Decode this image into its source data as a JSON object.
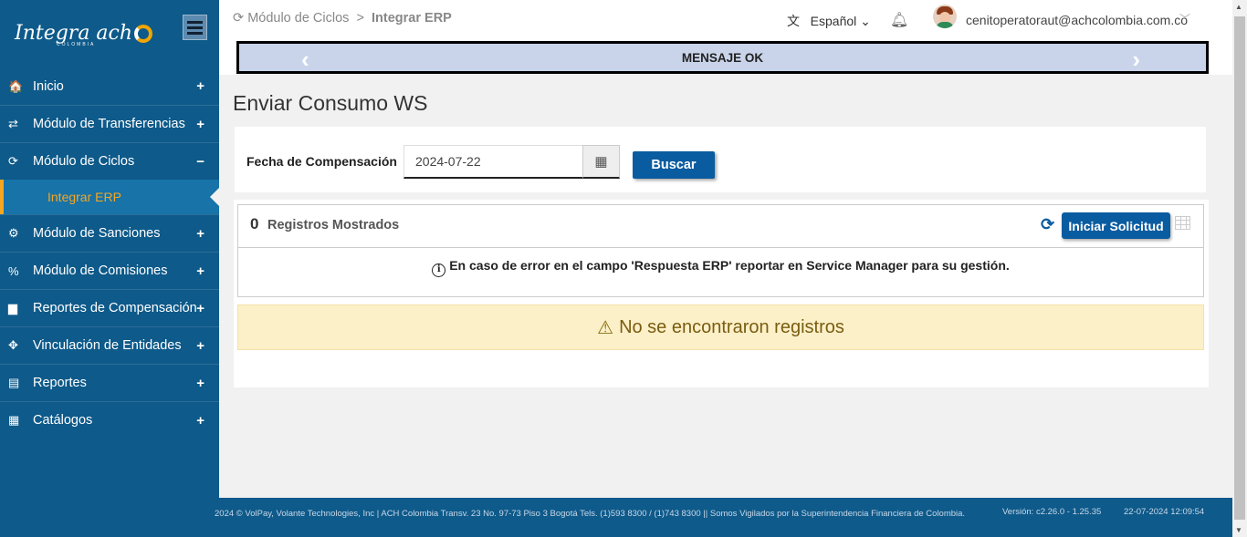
{
  "sidebar": {
    "logo_text": "Integra ach",
    "logo_sub": "COLOMBIA",
    "items": [
      {
        "icon": "home-icon",
        "glyph": "🏠",
        "label": "Inicio",
        "sign": "+"
      },
      {
        "icon": "exchange-icon",
        "glyph": "⇄",
        "label": "Módulo de Transferencias",
        "sign": "+"
      },
      {
        "icon": "refresh-icon",
        "glyph": "⟳",
        "label": "Módulo de Ciclos",
        "sign": "−"
      },
      {
        "icon": "gear-icon",
        "glyph": "⚙",
        "label": "Módulo de Sanciones",
        "sign": "+"
      },
      {
        "icon": "percent-icon",
        "glyph": "%",
        "label": "Módulo de Comisiones",
        "sign": "+"
      },
      {
        "icon": "file-icon",
        "glyph": "▆",
        "label": "Reportes de Compensación",
        "sign": "+"
      },
      {
        "icon": "link-icon",
        "glyph": "✥",
        "label": "Vinculación de Entidades",
        "sign": "+"
      },
      {
        "icon": "report-icon",
        "glyph": "▤",
        "label": "Reportes",
        "sign": "+"
      },
      {
        "icon": "catalog-icon",
        "glyph": "▦",
        "label": "Catálogos",
        "sign": "+"
      }
    ],
    "sub_item": "Integrar ERP"
  },
  "header": {
    "breadcrumb_parent": "Módulo de Ciclos",
    "breadcrumb_sep": ">",
    "breadcrumb_current": "Integrar ERP",
    "language": "Español",
    "user_email": "cenitoperatoraut@achcolombia.com.co",
    "message": "MENSAJE OK"
  },
  "main": {
    "title": "Enviar Consumo WS",
    "filter_label": "Fecha de Compensación",
    "date_value": "2024-07-22",
    "search_button": "Buscar",
    "records_count": "0",
    "records_label": "Registros Mostrados",
    "start_button": "Iniciar Solicitud",
    "info_text": "En caso de error en el campo 'Respuesta ERP' reportar en Service Manager para su gestión.",
    "empty_text": "No se encontraron registros"
  },
  "footer": {
    "copyright": "2024 © VolPay, Volante Technologies, Inc | ACH Colombia Transv. 23 No. 97-73 Piso 3 Bogotá Tels. (1)593 8300 / (1)743 8300 || Somos Vigilados por la Superintendencia Financiera de Colombia.",
    "version": "Versión: c2.26.0 - 1.25.35",
    "timestamp": "22-07-2024 12:09:54"
  },
  "colors": {
    "sidebar": "#0e5a8a",
    "accent": "#f5a623",
    "primary_button": "#0a5ca0",
    "warning_bg": "#fcf0c8"
  }
}
